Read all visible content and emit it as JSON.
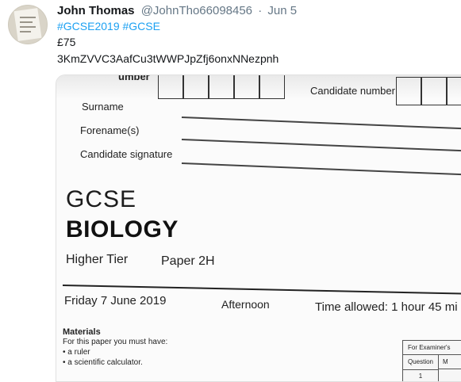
{
  "tweet": {
    "author_name": "John Thomas",
    "handle": "@JohnTho66098456",
    "separator": "·",
    "date": "Jun 5",
    "hashtag1": "#GCSE2019",
    "hashtag2": "#GCSE",
    "price": "£75",
    "code": "3KmZVVC3AafCu3tWWPJpZfj6onxNNezpnh"
  },
  "photo": {
    "fragment": "umber",
    "candidate_number_label": "Candidate number",
    "surname_label": "Surname",
    "forenames_label": "Forename(s)",
    "signature_label": "Candidate signature",
    "exam_board": "GCSE",
    "subject": "BIOLOGY",
    "tier": "Higher Tier",
    "paper": "Paper 2H",
    "exam_date": "Friday 7 June 2019",
    "session": "Afternoon",
    "time_allowed": "Time allowed: 1 hour 45 mi",
    "materials_heading": "Materials",
    "materials_intro": "For this paper you must have:",
    "materials_items": [
      "• a ruler",
      "• a scientific calculator."
    ],
    "examiner_table": {
      "header": "For Examiner's",
      "col_question": "Question",
      "col_mark": "M",
      "row1": "1"
    }
  }
}
